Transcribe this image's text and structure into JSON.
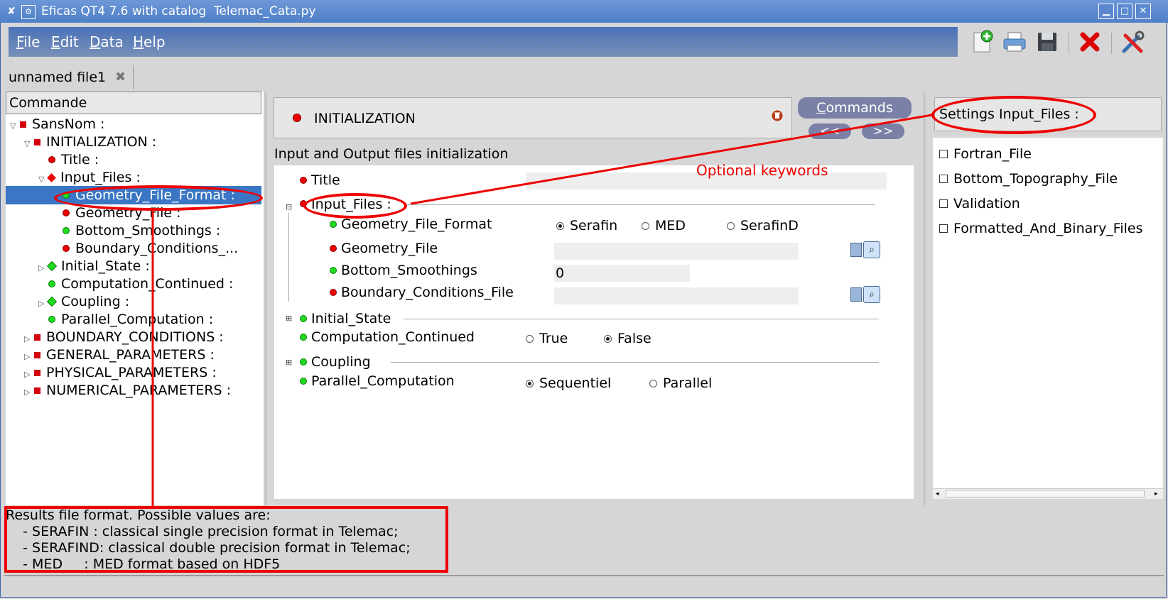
{
  "window": {
    "title": "Eficas QT4 7.6 with catalog  Telemac_Cata.py",
    "minimize_glyph": "▁",
    "maximize_glyph": "□",
    "close_glyph": "✕"
  },
  "menu": {
    "items": [
      {
        "accel": "F",
        "rest": "ile"
      },
      {
        "accel": "E",
        "rest": "dit"
      },
      {
        "accel": "D",
        "rest": "ata"
      },
      {
        "accel": "H",
        "rest": "elp"
      }
    ]
  },
  "toolbar": {
    "icons": [
      "new-file-icon",
      "print-icon",
      "save-icon",
      "delete-icon",
      "tools-icon"
    ]
  },
  "tab": {
    "label": "unnamed file1",
    "close_glyph": "✖"
  },
  "tree": {
    "header": "Commande",
    "rows": [
      {
        "label": "SansNom :"
      },
      {
        "label": "INITIALIZATION :"
      },
      {
        "label": "Title :"
      },
      {
        "label": "Input_Files :"
      },
      {
        "label": "Geometry_File_Format :"
      },
      {
        "label": "Geometry_File :"
      },
      {
        "label": "Bottom_Smoothings :"
      },
      {
        "label": "Boundary_Conditions_..."
      },
      {
        "label": "Initial_State :"
      },
      {
        "label": "Computation_Continued :"
      },
      {
        "label": "Coupling :"
      },
      {
        "label": "Parallel_Computation :"
      },
      {
        "label": "BOUNDARY_CONDITIONS :"
      },
      {
        "label": "GENERAL_PARAMETERS :"
      },
      {
        "label": "PHYSICAL_PARAMETERS :"
      },
      {
        "label": "NUMERICAL_PARAMETERS :"
      }
    ]
  },
  "command": {
    "name": "INITIALIZATION",
    "description": "Input and Output files initialization",
    "commands_button": {
      "accel": "C",
      "rest": "ommands"
    },
    "prev_button": "<<",
    "next_button": ">>"
  },
  "form": {
    "title_label": "Title",
    "title_value": "",
    "input_files_label": "Input_Files :",
    "input_files_expander": "⊟",
    "geometry_file_format_label": "Geometry_File_Format",
    "geometry_file_format_options": [
      "Serafin",
      "MED",
      "SerafinD"
    ],
    "geometry_file_label": "Geometry_File",
    "geometry_file_value": "",
    "bottom_smoothings_label": "Bottom_Smoothings",
    "bottom_smoothings_value": "0",
    "boundary_conditions_file_label": "Boundary_Conditions_File",
    "boundary_conditions_file_value": "",
    "initial_state_label": "Initial_State",
    "initial_state_expander": "⊞",
    "computation_continued_label": "Computation_Continued",
    "computation_continued_options": [
      "True",
      "False"
    ],
    "coupling_label": "Coupling",
    "coupling_expander": "⊞",
    "parallel_computation_label": "Parallel_Computation",
    "parallel_computation_options": [
      "Sequentiel",
      "Parallel"
    ]
  },
  "optional": {
    "header": "Settings Input_Files :",
    "items": [
      "Fortran_File",
      "Bottom_Topography_File",
      "Validation",
      "Formatted_And_Binary_Files"
    ]
  },
  "annotation": {
    "text": "Optional keywords"
  },
  "help_text": {
    "lines": [
      "Results file format. Possible values are:",
      "    - SERAFIN : classical single precision format in Telemac;",
      "    - SERAFIND: classical double precision format in Telemac;",
      "    - MED     : MED format based on HDF5"
    ]
  },
  "colors": {
    "accent_red": "#e00000",
    "selected_blue": "#3a76c4",
    "status_green": "#1fdc1f"
  }
}
